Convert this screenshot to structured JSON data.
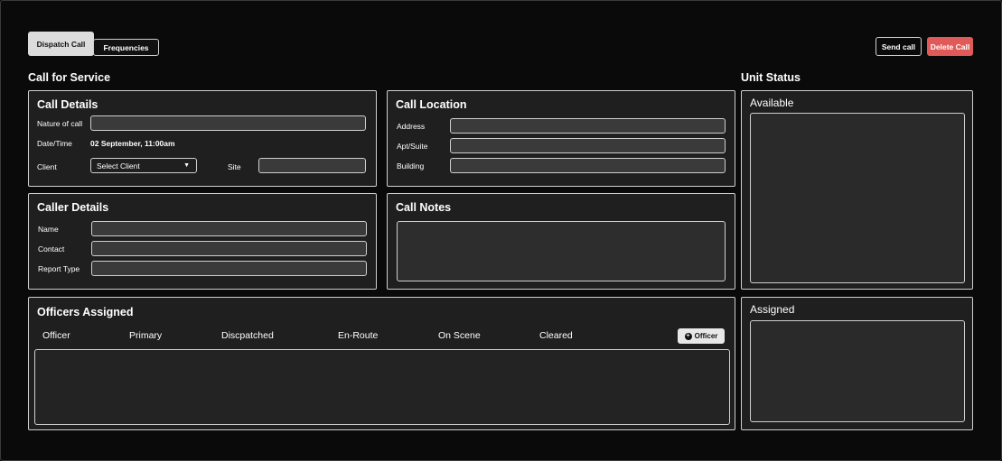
{
  "tabs": [
    {
      "label": "Dispatch Call",
      "active": true
    },
    {
      "label": "Frequencies",
      "active": false
    }
  ],
  "actions": {
    "send_label": "Send call",
    "delete_label": "Delete Call"
  },
  "headings": {
    "call_for_service": "Call for Service",
    "unit_status": "Unit Status"
  },
  "call_details": {
    "title": "Call Details",
    "nature_label": "Nature of call",
    "nature_value": "",
    "datetime_label": "Date/Time",
    "datetime_value": "02 September, 11:00am",
    "client_label": "Client",
    "client_selected": "Select Client",
    "site_label": "Site",
    "site_value": ""
  },
  "call_location": {
    "title": "Call Location",
    "address_label": "Address",
    "apt_label": "Apt/Suite",
    "building_label": "Building"
  },
  "caller_details": {
    "title": "Caller Details",
    "name_label": "Name",
    "contact_label": "Contact",
    "report_type_label": "Report Type"
  },
  "call_notes": {
    "title": "Call Notes"
  },
  "officers": {
    "title": "Officers Assigned",
    "columns": [
      "Officer",
      "Primary",
      "Discpatched",
      "En-Route",
      "On Scene",
      "Cleared"
    ],
    "add_label": "Officer"
  },
  "unit_status": {
    "available_title": "Available",
    "assigned_title": "Assigned"
  },
  "colors": {
    "background": "#0a0a0a",
    "panel": "#1f1f1f",
    "field": "#3a3a3a",
    "border": "#cfcfcf",
    "danger": "#e05a5a"
  }
}
